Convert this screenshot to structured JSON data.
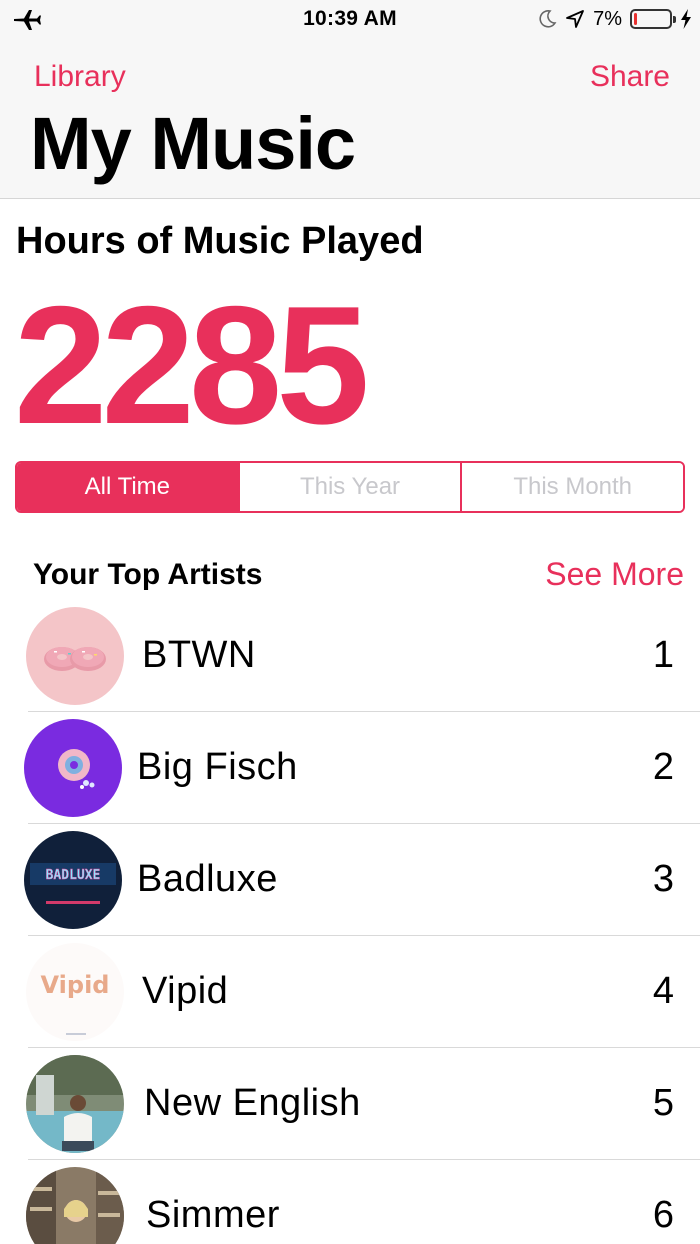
{
  "status_bar": {
    "time": "10:39 AM",
    "battery_percent": "7%",
    "battery_level": 0.07,
    "icons": [
      "airplane-icon",
      "moon-icon",
      "location-arrow-icon",
      "battery-icon",
      "charging-bolt-icon"
    ]
  },
  "nav": {
    "back_label": "Library",
    "share_label": "Share",
    "title": "My Music"
  },
  "hours": {
    "heading": "Hours of Music Played",
    "value": "2285"
  },
  "period_tabs": [
    {
      "label": "All Time",
      "selected": true
    },
    {
      "label": "This Year",
      "selected": false
    },
    {
      "label": "This Month",
      "selected": false
    }
  ],
  "top_artists": {
    "heading": "Your Top Artists",
    "see_more_label": "See More",
    "items": [
      {
        "name": "BTWN",
        "rank": "1",
        "artwork": "pink-donuts-artwork",
        "artwork_text": ""
      },
      {
        "name": "Big Fisch",
        "rank": "2",
        "artwork": "purple-donut-artwork",
        "artwork_text": ""
      },
      {
        "name": "Badluxe",
        "rank": "3",
        "artwork": "badluxe-neon-artwork",
        "artwork_text": "BADLUXE"
      },
      {
        "name": "Vipid",
        "rank": "4",
        "artwork": "vipid-logo-artwork",
        "artwork_text": "Vipid"
      },
      {
        "name": "New English",
        "rank": "5",
        "artwork": "waterfall-photo-artwork",
        "artwork_text": ""
      },
      {
        "name": "Simmer",
        "rank": "6",
        "artwork": "portrait-photo-artwork",
        "artwork_text": ""
      }
    ]
  },
  "colors": {
    "accent": "#e8305b",
    "inactive_tab_text": "#c8c8cc",
    "header_bg": "#f7f7f7",
    "battery_low": "#e8312f"
  }
}
